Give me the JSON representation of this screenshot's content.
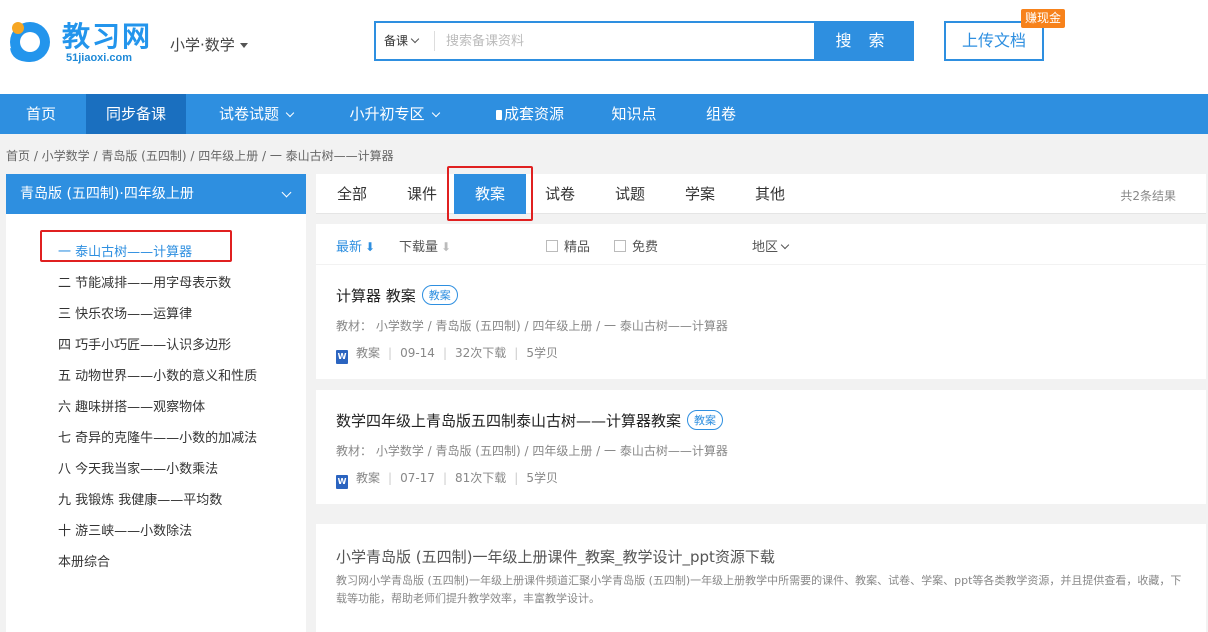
{
  "header": {
    "logo_text": "教习网",
    "logo_sub": "51jiaoxi.com",
    "subject": "小学·数学",
    "search_type": "备课",
    "search_placeholder": "搜索备课资料",
    "search_button": "搜 索",
    "upload_button": "上传文档",
    "earn_badge": "赚现金"
  },
  "nav": {
    "items": [
      {
        "label": "首页"
      },
      {
        "label": "同步备课"
      },
      {
        "label": "试卷试题"
      },
      {
        "label": "小升初专区"
      },
      {
        "label": "成套资源"
      },
      {
        "label": "知识点"
      },
      {
        "label": "组卷"
      }
    ]
  },
  "breadcrumb": "首页 /  小学数学 / 青岛版 (五四制) / 四年级上册 / 一 泰山古树——计算器",
  "sidebar": {
    "title": "青岛版 (五四制)·四年级上册",
    "chapters": [
      "一 泰山古树——计算器",
      "二 节能减排——用字母表示数",
      "三 快乐农场——运算律",
      "四 巧手小巧匠——认识多边形",
      "五 动物世界——小数的意义和性质",
      "六 趣味拼搭——观察物体",
      "七 奇异的克隆牛——小数的加减法",
      "八 今天我当家——小数乘法",
      "九 我锻炼 我健康——平均数",
      "十 游三峡——小数除法",
      "本册综合"
    ]
  },
  "tabs": {
    "items": [
      "全部",
      "课件",
      "教案",
      "试卷",
      "试题",
      "学案",
      "其他"
    ],
    "result_count": "共2条结果"
  },
  "filters": {
    "latest": "最新",
    "downloads": "下载量",
    "premium": "精品",
    "free": "免费",
    "region": "地区"
  },
  "results": [
    {
      "title": "计算器 教案",
      "tag": "教案",
      "meta": "教材：  小学数学  /  青岛版 (五四制)  /  四年级上册  /  一 泰山古树——计算器",
      "type": "教案",
      "date": "09-14",
      "downloads": "32次下载",
      "points": "5学贝"
    },
    {
      "title": "数学四年级上青岛版五四制泰山古树——计算器教案",
      "tag": "教案",
      "meta": "教材：  小学数学  /  青岛版 (五四制)  /  四年级上册  /  一 泰山古树——计算器",
      "type": "教案",
      "date": "07-17",
      "downloads": "81次下载",
      "points": "5学贝"
    }
  ],
  "promo": {
    "title": "小学青岛版 (五四制)一年级上册课件_教案_教学设计_ppt资源下载",
    "desc": "教习网小学青岛版 (五四制)一年级上册课件频道汇聚小学青岛版 (五四制)一年级上册教学中所需要的课件、教案、试卷、学案、ppt等各类教学资源，并且提供查看，收藏，下载等功能，帮助老师们提升教学效率，丰富教学设计。"
  },
  "icons": {
    "word": "W"
  },
  "colors": {
    "primary": "#2e8fe0",
    "nav_active": "#1a6fbf",
    "highlight": "#e02020",
    "badge": "#f7821b"
  }
}
